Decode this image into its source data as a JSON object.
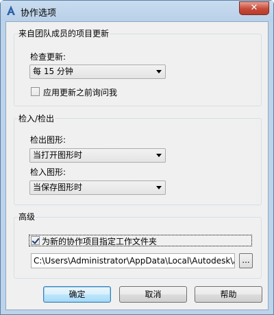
{
  "window": {
    "title": "协作选项",
    "close_label": "✕"
  },
  "updates_group": {
    "legend": "来自团队成员的项目更新",
    "check_label": "检查更新:",
    "check_value": "每 15 分钟",
    "ask_checkbox": {
      "label": "应用更新之前询问我",
      "checked": false
    }
  },
  "checkin_group": {
    "legend": "检入/检出",
    "checkout_label": "检出图形:",
    "checkout_value": "当打开图形时",
    "checkin_label": "检入图形:",
    "checkin_value": "当保存图形时"
  },
  "advanced_group": {
    "legend": "高级",
    "folder_checkbox": {
      "label": "为新的协作项目指定工作文件夹",
      "checked": true
    },
    "folder_path": "C:\\Users\\Administrator\\AppData\\Local\\Autodesk\\AutoCAD",
    "browse_label": "..."
  },
  "buttons": {
    "ok": "确定",
    "cancel": "取消",
    "help": "帮助"
  },
  "colors": {
    "title_bar": "#bcd3ea",
    "close_button": "#c74a3a",
    "default_button": "#a7d9f5"
  }
}
